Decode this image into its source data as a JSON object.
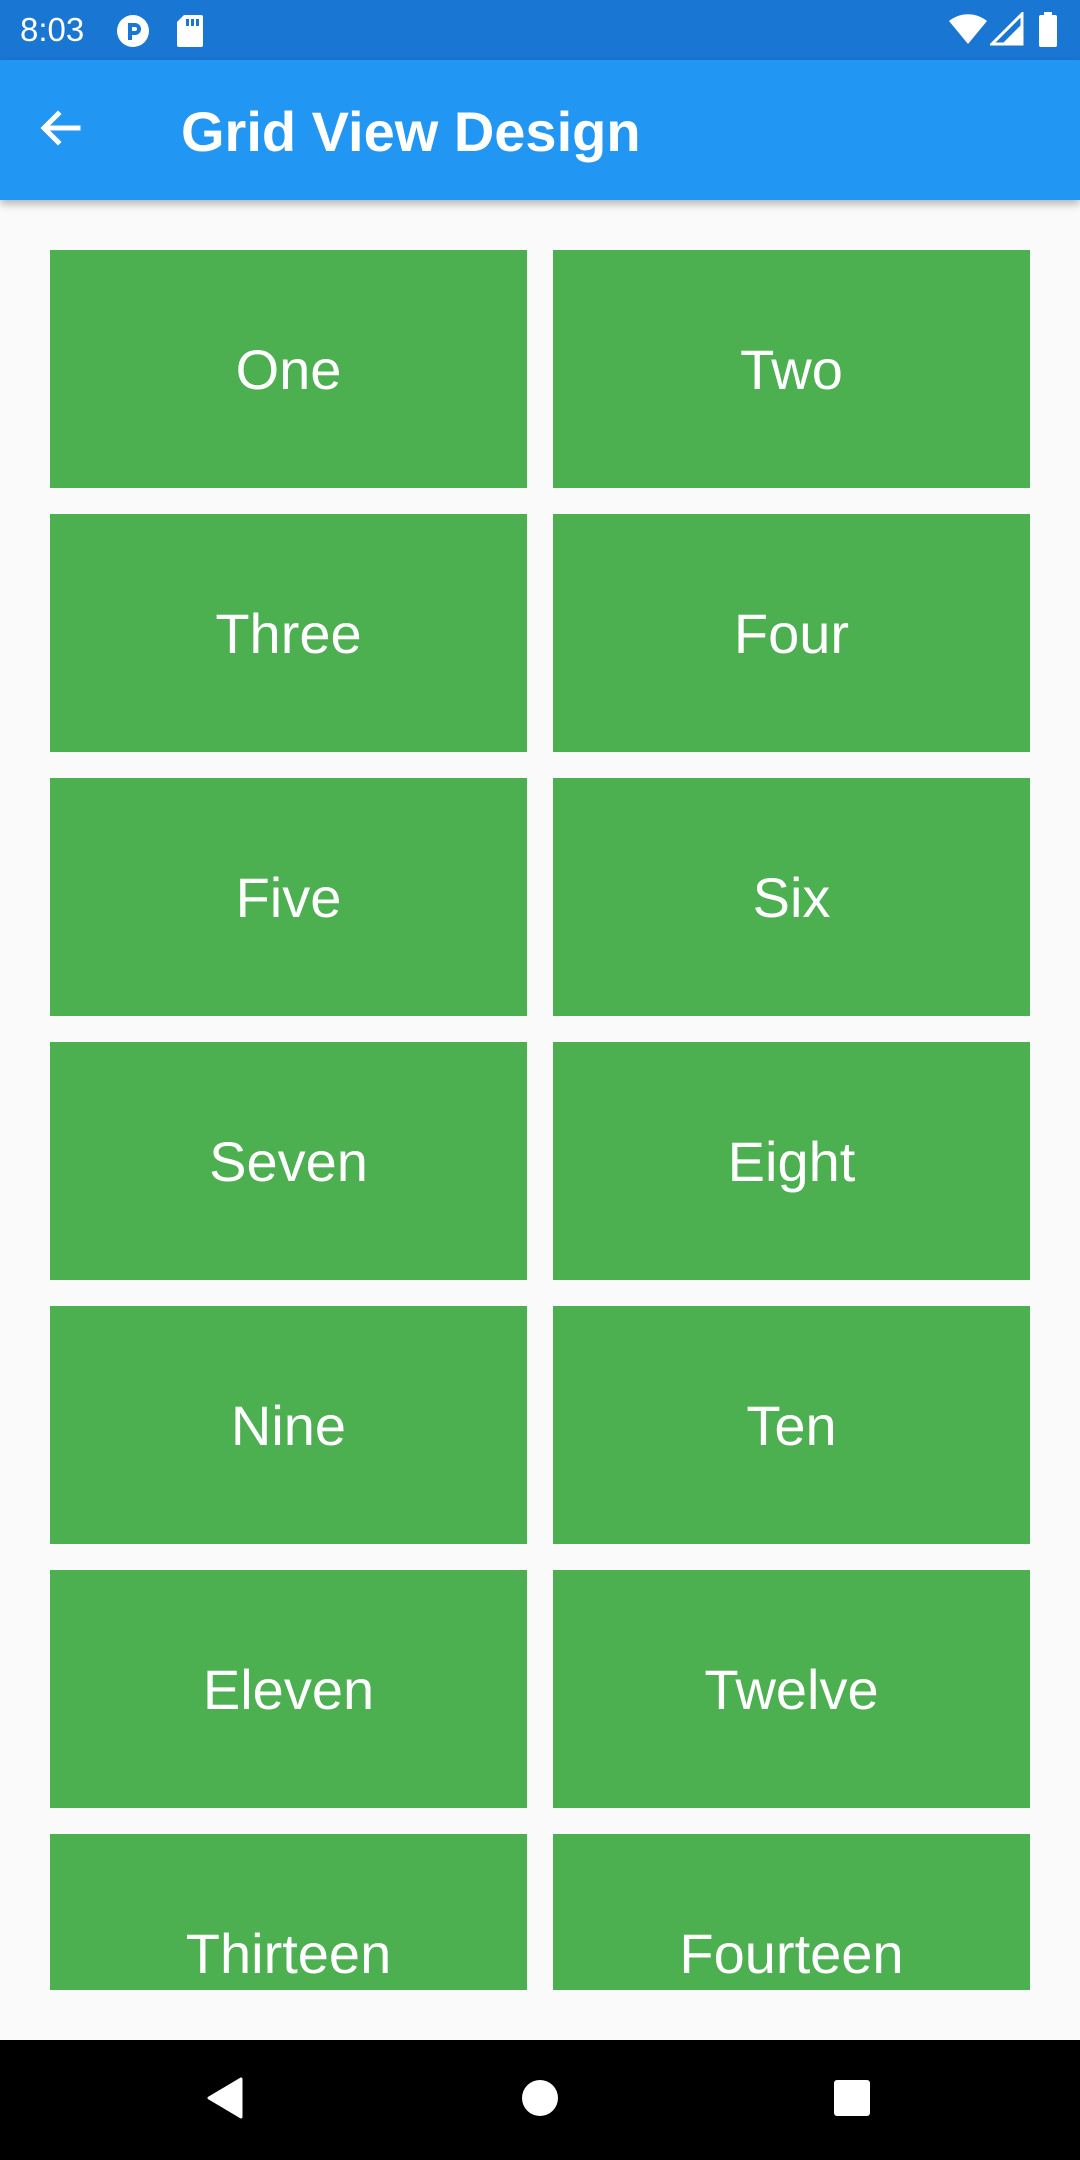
{
  "status_bar": {
    "time": "8:03",
    "color": "#1976d2",
    "left_icons": [
      "sync-icon",
      "sd-card-icon"
    ],
    "right_icons": [
      "wifi-icon",
      "signal-icon",
      "battery-icon"
    ]
  },
  "app_bar": {
    "title": "Grid View Design",
    "back_icon": "arrow-back-icon",
    "color": "#2196f3"
  },
  "grid": {
    "tile_color": "#4caf50",
    "items": [
      {
        "label": "One"
      },
      {
        "label": "Two"
      },
      {
        "label": "Three"
      },
      {
        "label": "Four"
      },
      {
        "label": "Five"
      },
      {
        "label": "Six"
      },
      {
        "label": "Seven"
      },
      {
        "label": "Eight"
      },
      {
        "label": "Nine"
      },
      {
        "label": "Ten"
      },
      {
        "label": "Eleven"
      },
      {
        "label": "Twelve"
      },
      {
        "label": "Thirteen"
      },
      {
        "label": "Fourteen"
      }
    ]
  },
  "nav_bar": {
    "buttons": [
      "back-triangle-icon",
      "home-circle-icon",
      "recents-square-icon"
    ]
  }
}
